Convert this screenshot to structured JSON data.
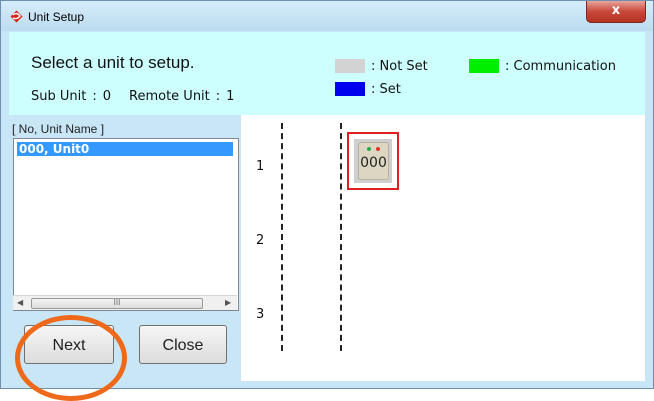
{
  "window": {
    "title": "Unit Setup",
    "close_glyph": "x",
    "icon": "app-logo-icon"
  },
  "header": {
    "prompt": "Select a unit to setup.",
    "sub_unit_label": "Sub Unit",
    "sub_unit_sep": ":",
    "sub_unit_value": "0",
    "remote_unit_label": "Remote Unit",
    "remote_unit_sep": ":",
    "remote_unit_value": "1",
    "legend": [
      {
        "label": ": Not Set",
        "color": "#d3d3d3"
      },
      {
        "label": ": Communication",
        "color": "#00ee00"
      },
      {
        "label": ": Set",
        "color": "#0000ee"
      }
    ]
  },
  "unit_list": {
    "header": "[ No, Unit Name ]",
    "items": [
      "000, Unit0"
    ],
    "scrollbar_thumb_glyph": "III"
  },
  "buttons": {
    "next": "Next",
    "close": "Close"
  },
  "canvas": {
    "rows": [
      "1",
      "2",
      "3"
    ],
    "units": [
      {
        "label": "000",
        "status": "Not Set",
        "selected": true
      }
    ]
  },
  "colors": {
    "accent_selection": "#3399ff",
    "annotation": "#ee6a1a",
    "selected_border": "#e02020"
  }
}
